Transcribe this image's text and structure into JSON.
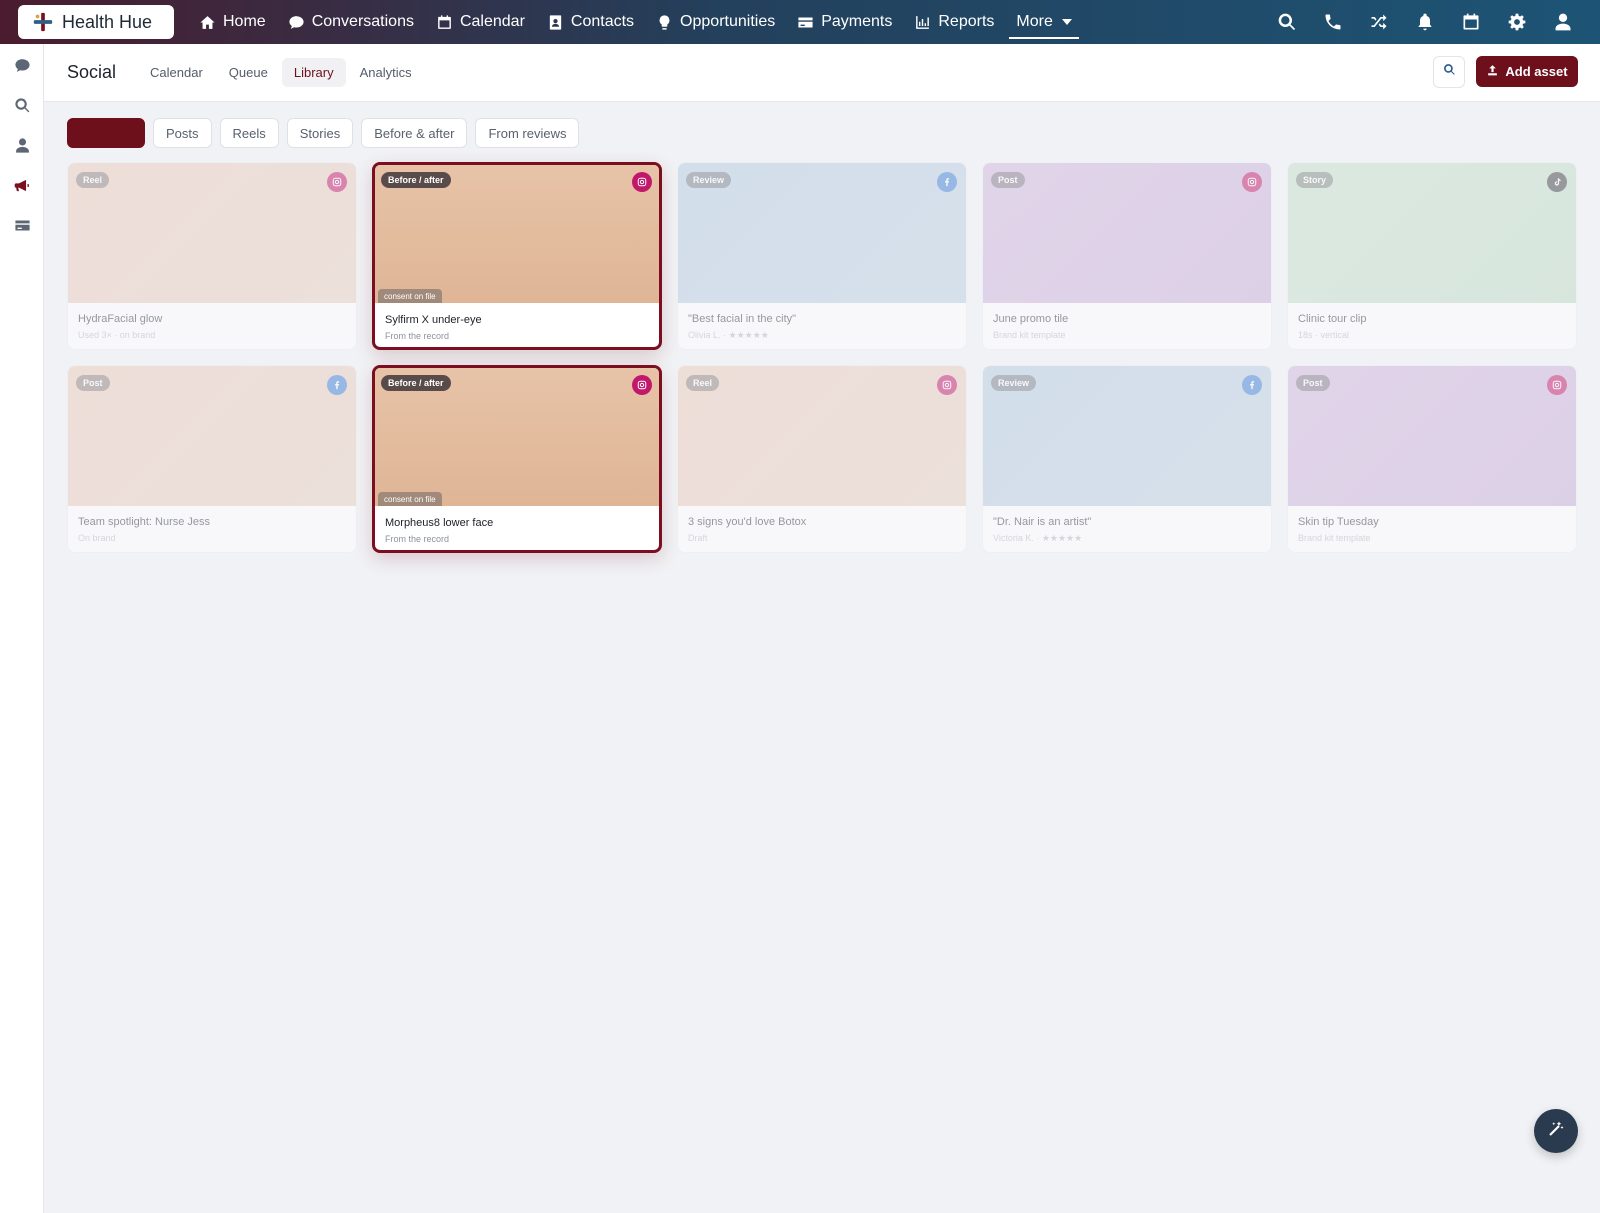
{
  "brand": {
    "name": "Health Hue",
    "logo_icon": "health-hue-logo"
  },
  "topnav": {
    "items": [
      {
        "label": "Home",
        "icon": "home-icon"
      },
      {
        "label": "Conversations",
        "icon": "chat-bubble-icon"
      },
      {
        "label": "Calendar",
        "icon": "calendar-icon"
      },
      {
        "label": "Contacts",
        "icon": "contact-card-icon"
      },
      {
        "label": "Opportunities",
        "icon": "lightbulb-icon"
      },
      {
        "label": "Payments",
        "icon": "credit-card-icon"
      },
      {
        "label": "Reports",
        "icon": "bar-chart-icon"
      }
    ],
    "more_label": "More",
    "right_icons": [
      "search-icon",
      "phone-icon",
      "shuffle-icon",
      "bell-icon",
      "calendar-icon",
      "gear-icon",
      "user-icon"
    ]
  },
  "rail": {
    "icons": [
      "chat-icon",
      "search-icon",
      "user-icon",
      "megaphone-icon",
      "card-icon"
    ],
    "active": "megaphone-icon"
  },
  "subheader": {
    "title": "Social",
    "tabs": [
      "Calendar",
      "Queue",
      "Library",
      "Analytics"
    ],
    "active_tab": "Library",
    "add_label": "Add asset"
  },
  "filters": {
    "active_label": "",
    "chips": [
      "Posts",
      "Reels",
      "Stories",
      "Before & after",
      "From reviews"
    ]
  },
  "cards": [
    {
      "tag": "Reel",
      "title": "HydraFacial glow",
      "sub": "Used 3× · on brand",
      "platform": "instagram",
      "bg": "peach",
      "selected": false
    },
    {
      "tag": "Before / after",
      "title": "Sylfirm X under-eye",
      "sub": "From the record",
      "platform": "instagram",
      "bg": "tan",
      "selected": true,
      "consent": "consent on file"
    },
    {
      "tag": "Review",
      "title": "\"Best facial in the city\"",
      "sub": "Olivia L. · ★★★★★",
      "platform": "facebook",
      "bg": "blue",
      "selected": false
    },
    {
      "tag": "Post",
      "title": "June promo tile",
      "sub": "Brand kit template",
      "platform": "instagram",
      "bg": "lilac",
      "selected": false
    },
    {
      "tag": "Story",
      "title": "Clinic tour clip",
      "sub": "18s · vertical",
      "platform": "tiktok",
      "bg": "mint",
      "selected": false
    },
    {
      "tag": "Post",
      "title": "Team spotlight: Nurse Jess",
      "sub": "On brand",
      "platform": "facebook",
      "bg": "peach",
      "selected": false
    },
    {
      "tag": "Before / after",
      "title": "Morpheus8 lower face",
      "sub": "From the record",
      "platform": "instagram",
      "bg": "tan",
      "selected": true,
      "consent": "consent on file"
    },
    {
      "tag": "Reel",
      "title": "3 signs you'd love Botox",
      "sub": "Draft",
      "platform": "instagram",
      "bg": "peach",
      "selected": false
    },
    {
      "tag": "Review",
      "title": "\"Dr. Nair is an artist\"",
      "sub": "Victoria K. · ★★★★★",
      "platform": "facebook",
      "bg": "blue",
      "selected": false
    },
    {
      "tag": "Post",
      "title": "Skin tip Tuesday",
      "sub": "Brand kit template",
      "platform": "instagram",
      "bg": "lilac",
      "selected": false
    }
  ],
  "fab": {
    "icon": "magic-wand-icon"
  },
  "colors": {
    "brand_accent": "#6e0f1c",
    "instagram": "#c2186b",
    "facebook": "#3f7fd6",
    "tiktok": "#3f4348"
  }
}
